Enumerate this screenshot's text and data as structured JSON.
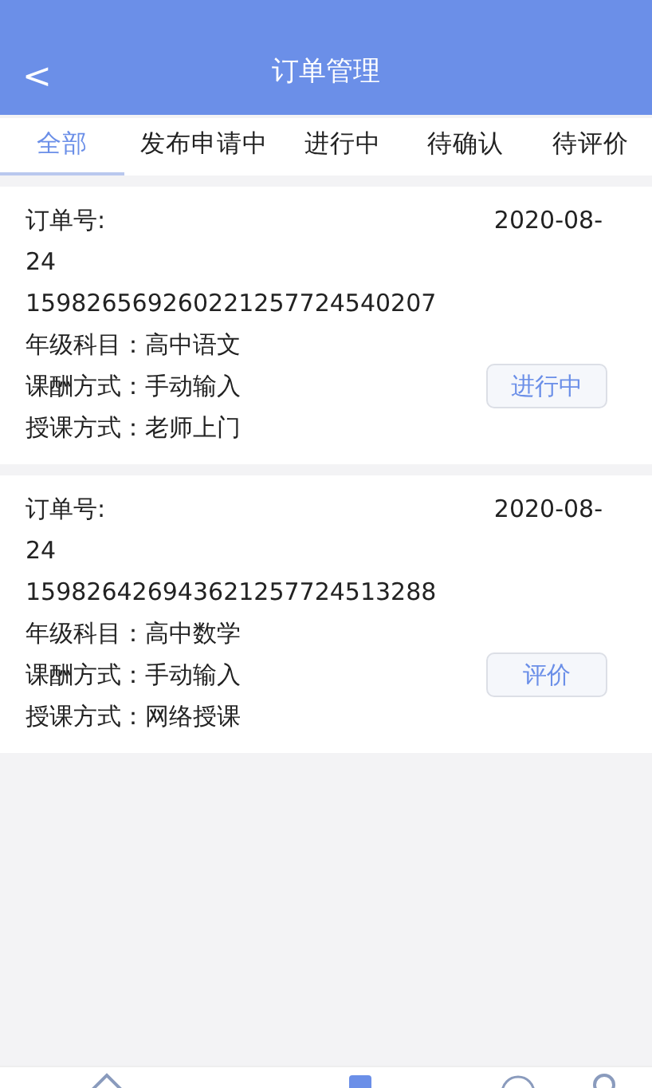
{
  "header": {
    "back": "<",
    "title": "订单管理"
  },
  "tabs": [
    {
      "label": "全部",
      "selected": true
    },
    {
      "label": "发布申请中",
      "selected": false
    },
    {
      "label": "进行中",
      "selected": false
    },
    {
      "label": "待确认",
      "selected": false
    },
    {
      "label": "待评价",
      "selected": false
    }
  ],
  "orders": [
    {
      "order_label": "订单号:",
      "date": "2020-08-",
      "date_cont": "24",
      "order_no": "159826569260221257724540207",
      "fields": [
        "年级科目：高中语文",
        "课酬方式：手动输入",
        "授课方式：老师上门"
      ],
      "action": "进行中"
    },
    {
      "order_label": "订单号:",
      "date": "2020-08-",
      "date_cont": "24",
      "order_no": "159826426943621257724513288",
      "fields": [
        "年级科目：高中数学",
        "课酬方式：手动输入",
        "授课方式：网络授课"
      ],
      "action": "评价"
    }
  ],
  "bottom_nav": [
    {
      "kind": "home",
      "selected": false
    },
    {
      "kind": "clipboard",
      "selected": true
    },
    {
      "kind": "circle",
      "selected": false
    },
    {
      "kind": "person",
      "selected": false
    }
  ]
}
